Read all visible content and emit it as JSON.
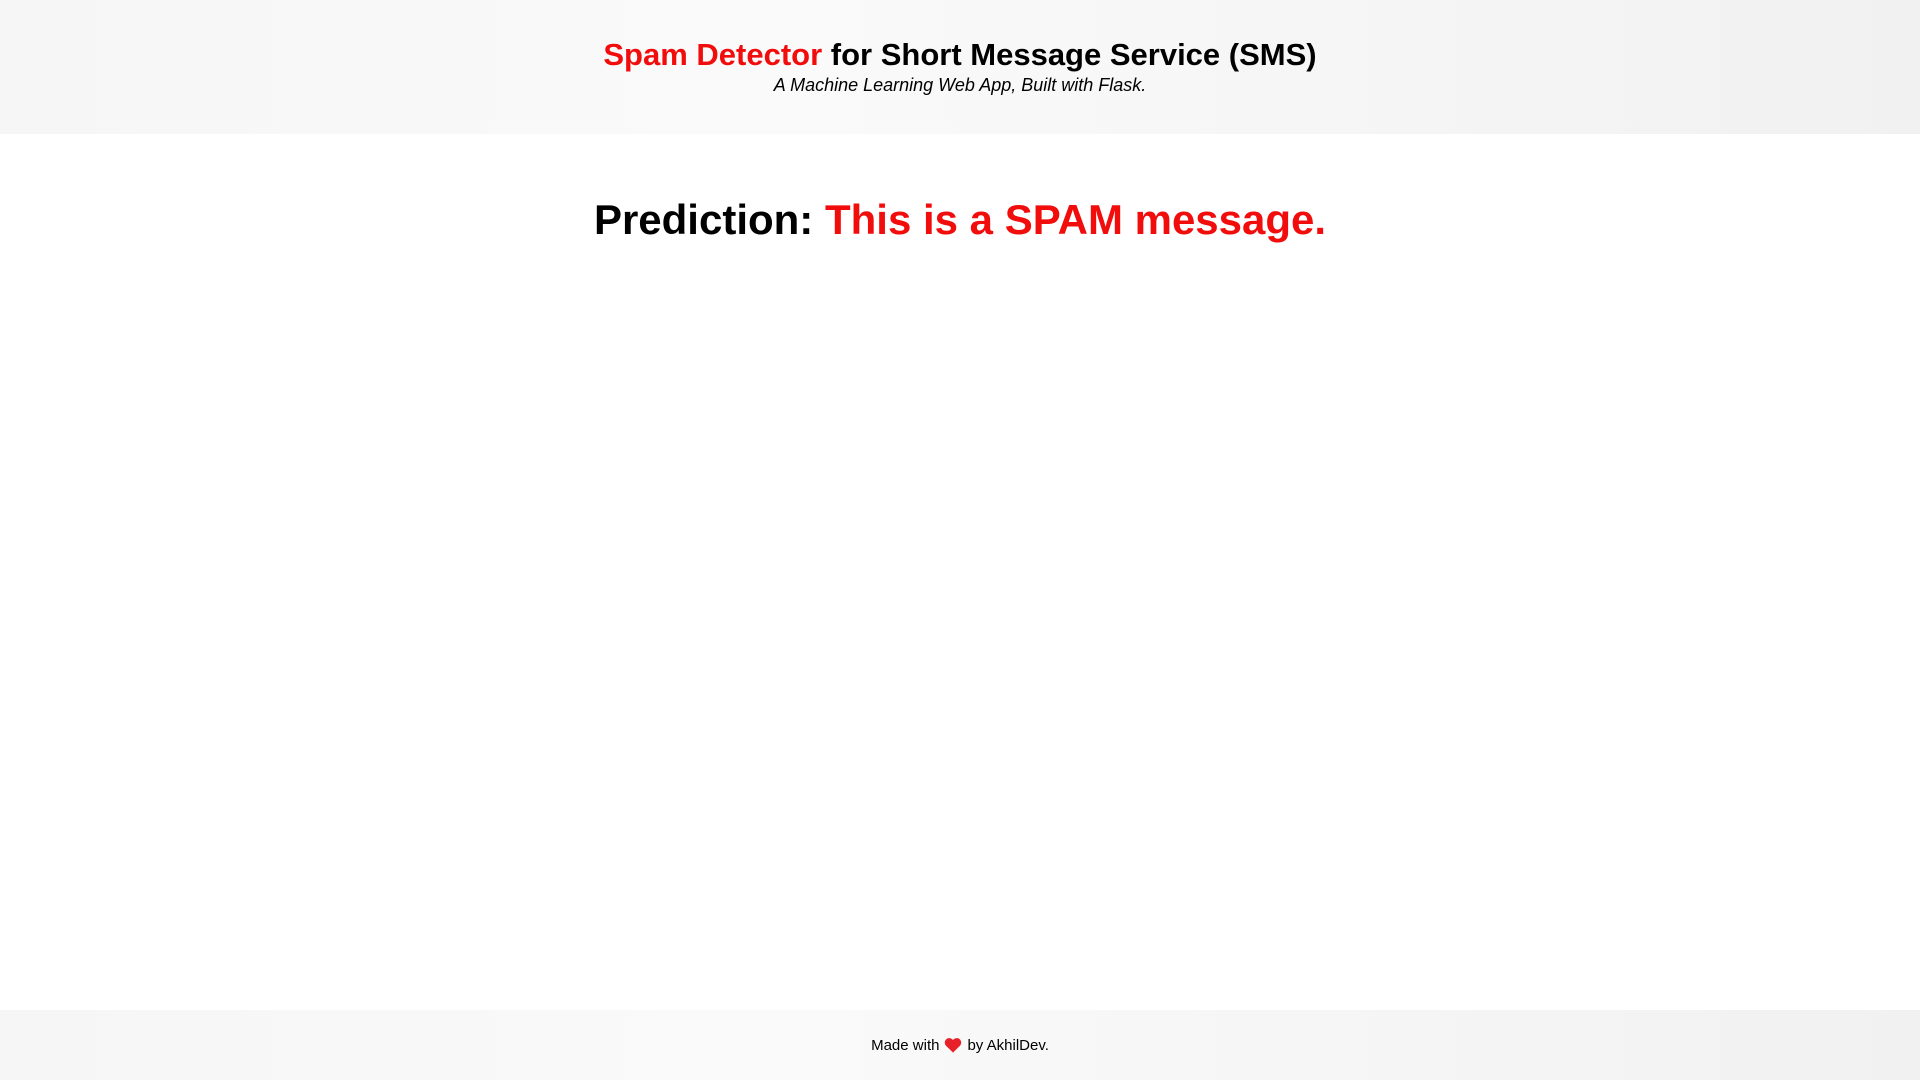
{
  "header": {
    "title_brand": "Spam Detector",
    "title_rest": " for Short Message Service (SMS)",
    "subtitle": "A Machine Learning Web App, Built with Flask."
  },
  "result": {
    "label": "Prediction: ",
    "value": "This is a SPAM message."
  },
  "footer": {
    "prefix": "Made with",
    "icon": "heart-icon",
    "suffix": "by AkhilDev."
  },
  "colors": {
    "accent": "#f20d0d",
    "text": "#000000",
    "band_background": "#f6f6f6",
    "page_background": "#ffffff"
  }
}
